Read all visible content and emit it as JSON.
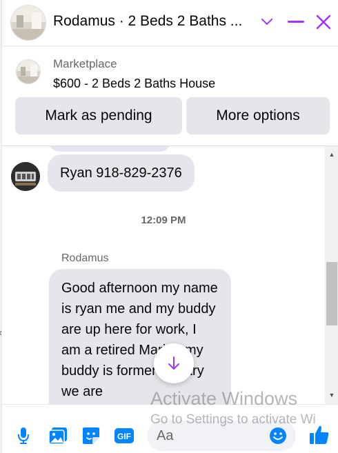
{
  "header": {
    "title": "Rodamus · 2 Beds 2 Baths ...",
    "accent": "#a033ff"
  },
  "marketplace": {
    "label": "Marketplace",
    "item": "$600 - 2 Beds 2 Baths House",
    "mark_pending_label": "Mark as pending",
    "more_options_label": "More options"
  },
  "messages": {
    "phone_text": "Ryan 918-829-2376",
    "timestamp": "12:09 PM",
    "sender": "Rodamus",
    "long_text": "Good afternoon my name is ryan me and my buddy are up here for work, I am a retired Marine my buddy is former military we are"
  },
  "composer": {
    "placeholder": "Aa",
    "icons": [
      "microphone-icon",
      "photo-icon",
      "sticker-icon",
      "gif-icon",
      "emoji-icon",
      "thumbs-up-icon"
    ],
    "gif_label": "GIF",
    "accent": "#0084ff"
  },
  "watermark": {
    "title": "Activate Windows",
    "subtitle": "Go to Settings to activate Wi"
  }
}
